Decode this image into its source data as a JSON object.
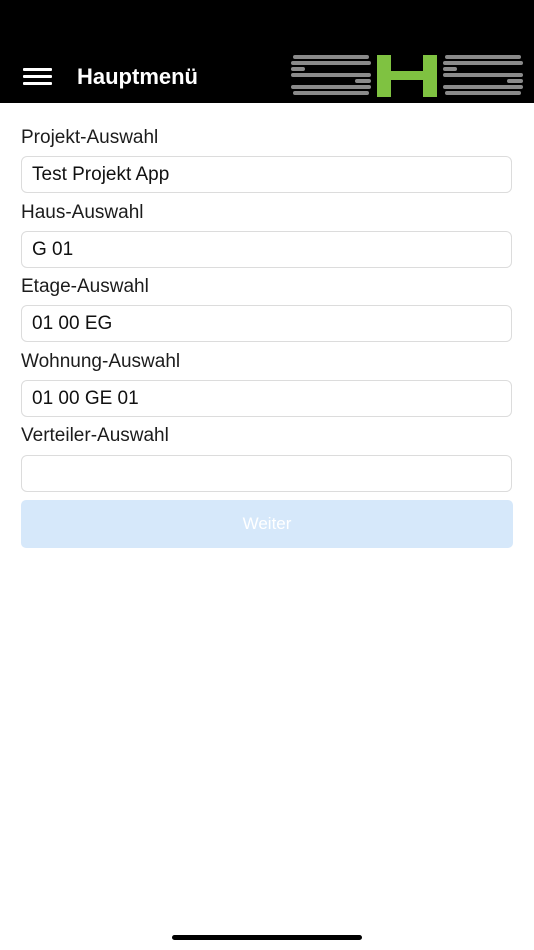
{
  "header": {
    "title": "Hauptmenü",
    "menu_icon": "hamburger-menu-icon",
    "logo_text": "SHS",
    "logo_colors": {
      "gray": "#8a8a8a",
      "green": "#7fc241"
    }
  },
  "form": {
    "fields": [
      {
        "label": "Projekt-Auswahl",
        "value": "Test Projekt App"
      },
      {
        "label": "Haus-Auswahl",
        "value": "G 01"
      },
      {
        "label": "Etage-Auswahl",
        "value": "01 00 EG"
      },
      {
        "label": "Wohnung-Auswahl",
        "value": "01 00 GE 01"
      },
      {
        "label": "Verteiler-Auswahl",
        "value": ""
      }
    ],
    "submit_label": "Weiter"
  },
  "colors": {
    "header_bg": "#000000",
    "button_disabled_bg": "#d6e8fa",
    "button_text": "#ffffff"
  }
}
